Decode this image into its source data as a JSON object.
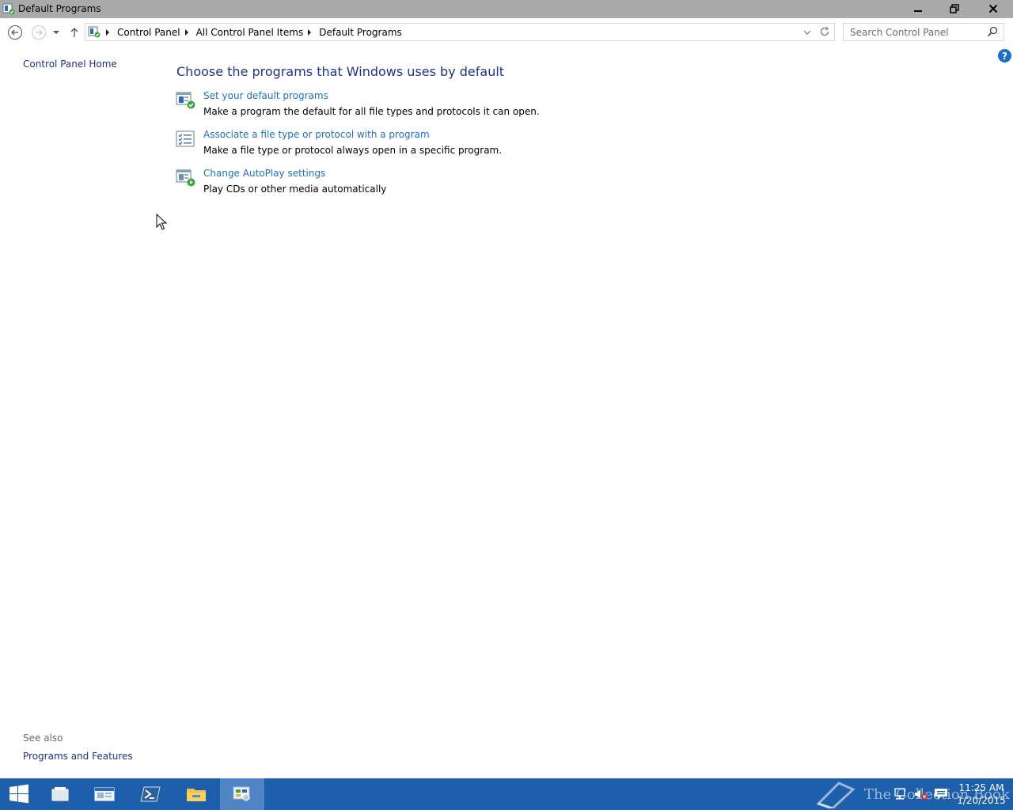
{
  "window": {
    "title": "Default Programs"
  },
  "address_bar": {
    "crumbs": [
      "Control Panel",
      "All Control Panel Items",
      "Default Programs"
    ]
  },
  "search": {
    "placeholder": "Search Control Panel"
  },
  "left_pane": {
    "home_link": "Control Panel Home",
    "see_also_label": "See also",
    "see_also_links": [
      "Programs and Features"
    ]
  },
  "help": {
    "label": "?"
  },
  "main": {
    "heading": "Choose the programs that Windows uses by default",
    "tasks": [
      {
        "link": "Set your default programs",
        "description": "Make a program the default for all file types and protocols it can open.",
        "icon": "default-programs-icon"
      },
      {
        "link": "Associate a file type or protocol with a program",
        "description": "Make a file type or protocol always open in a specific program.",
        "icon": "file-association-icon"
      },
      {
        "link": "Change AutoPlay settings",
        "description": "Play CDs or other media automatically",
        "icon": "autoplay-icon"
      }
    ]
  },
  "taskbar": {
    "items": [
      "start-icon",
      "task-view-icon",
      "server-manager-icon",
      "powershell-icon",
      "file-explorer-icon",
      "control-panel-icon"
    ],
    "watermark": "The Collection Book",
    "clock_time": "11:25 AM",
    "clock_date": "1/20/2015"
  },
  "colors": {
    "link": "#1e3287",
    "task_link": "#1e6fc7",
    "titlebar": "#a9a9a9",
    "taskbar": "#1d5faa"
  }
}
